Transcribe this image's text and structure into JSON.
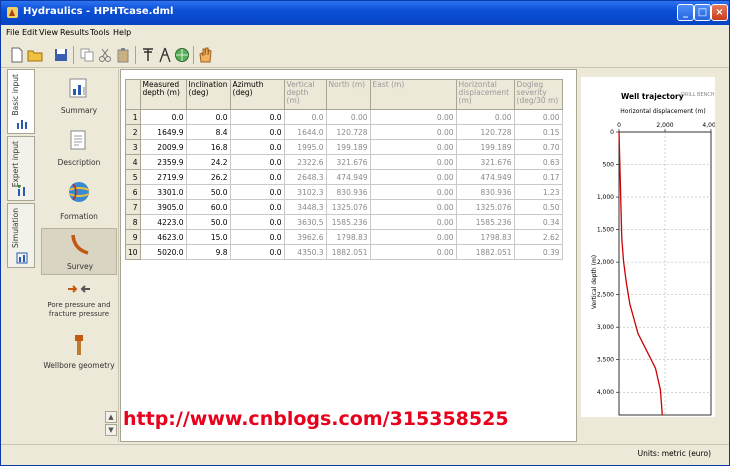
{
  "window": {
    "title": "Hydraulics - HPHTcase.dml"
  },
  "menu": [
    "File",
    "Edit",
    "View",
    "Results",
    "Tools",
    "Help"
  ],
  "toolbar_icons": [
    "new-icon",
    "open-icon",
    "save-icon",
    "copy-icon",
    "cut-icon",
    "paste-icon",
    "well-icon",
    "rig-icon",
    "globe-icon",
    "hand-icon"
  ],
  "vtabs": [
    {
      "label": "Basic input"
    },
    {
      "label": "Expert input"
    },
    {
      "label": "Simulation"
    }
  ],
  "nav": [
    {
      "label": "Summary",
      "icon": "summary-icon"
    },
    {
      "label": "Description",
      "icon": "description-icon"
    },
    {
      "label": "Formation",
      "icon": "formation-icon"
    },
    {
      "label": "Survey",
      "icon": "survey-icon"
    },
    {
      "label": "Pore pressure and fracture pressure",
      "icon": "pressure-icon"
    },
    {
      "label": "Wellbore geometry",
      "icon": "wellbore-icon"
    }
  ],
  "table": {
    "headers": [
      "",
      "Measured depth (m)",
      "Inclination (deg)",
      "Azimuth (deg)",
      "Vertical depth (m)",
      "North (m)",
      "East (m)",
      "Horizontal displacement (m)",
      "Dogleg severity (deg/30 m)"
    ],
    "rows": [
      [
        "1",
        "0.0",
        "0.0",
        "0.0",
        "0.0",
        "0.00",
        "0.00",
        "0.00",
        "0.00"
      ],
      [
        "2",
        "1649.9",
        "8.4",
        "0.0",
        "1644.0",
        "120.728",
        "0.00",
        "120.728",
        "0.15"
      ],
      [
        "3",
        "2009.9",
        "16.8",
        "0.0",
        "1995.0",
        "199.189",
        "0.00",
        "199.189",
        "0.70"
      ],
      [
        "4",
        "2359.9",
        "24.2",
        "0.0",
        "2322.6",
        "321.676",
        "0.00",
        "321.676",
        "0.63"
      ],
      [
        "5",
        "2719.9",
        "26.2",
        "0.0",
        "2648.3",
        "474.949",
        "0.00",
        "474.949",
        "0.17"
      ],
      [
        "6",
        "3301.0",
        "50.0",
        "0.0",
        "3102.3",
        "830.936",
        "0.00",
        "830.936",
        "1.23"
      ],
      [
        "7",
        "3905.0",
        "60.0",
        "0.0",
        "3448.3",
        "1325.076",
        "0.00",
        "1325.076",
        "0.50"
      ],
      [
        "8",
        "4223.0",
        "50.0",
        "0.0",
        "3630.5",
        "1585.236",
        "0.00",
        "1585.236",
        "0.34"
      ],
      [
        "9",
        "4623.0",
        "15.0",
        "0.0",
        "3962.6",
        "1798.83",
        "0.00",
        "1798.83",
        "2.62"
      ],
      [
        "10",
        "5020.0",
        "9.8",
        "0.0",
        "4350.3",
        "1882.051",
        "0.00",
        "1882.051",
        "0.39"
      ]
    ]
  },
  "chart_data": {
    "type": "line",
    "title": "Well trajectory",
    "brand": "DRILL BENCH",
    "xlabel": "Horizontal displacement (m)",
    "ylabel": "Vertical depth (m)",
    "xlim": [
      0,
      4000
    ],
    "ylim": [
      0,
      4350
    ],
    "xticks": [
      "0",
      "2,000",
      "4,000"
    ],
    "yticks": [
      "0",
      "500",
      "1,000",
      "1,500",
      "2,000",
      "2,500",
      "3,000",
      "3,500",
      "4,000"
    ],
    "grid": true,
    "color": "#cc0000",
    "x": [
      0,
      120.728,
      199.189,
      321.676,
      474.949,
      830.936,
      1325.076,
      1585.236,
      1798.83,
      1882.051
    ],
    "y": [
      0,
      1644.0,
      1995.0,
      2322.6,
      2648.3,
      3102.3,
      3448.3,
      3630.5,
      3962.6,
      4350.3
    ]
  },
  "overlay": {
    "url": "http://www.cnblogs.com/315358525"
  },
  "status": {
    "units": "Units: metric (euro)"
  }
}
